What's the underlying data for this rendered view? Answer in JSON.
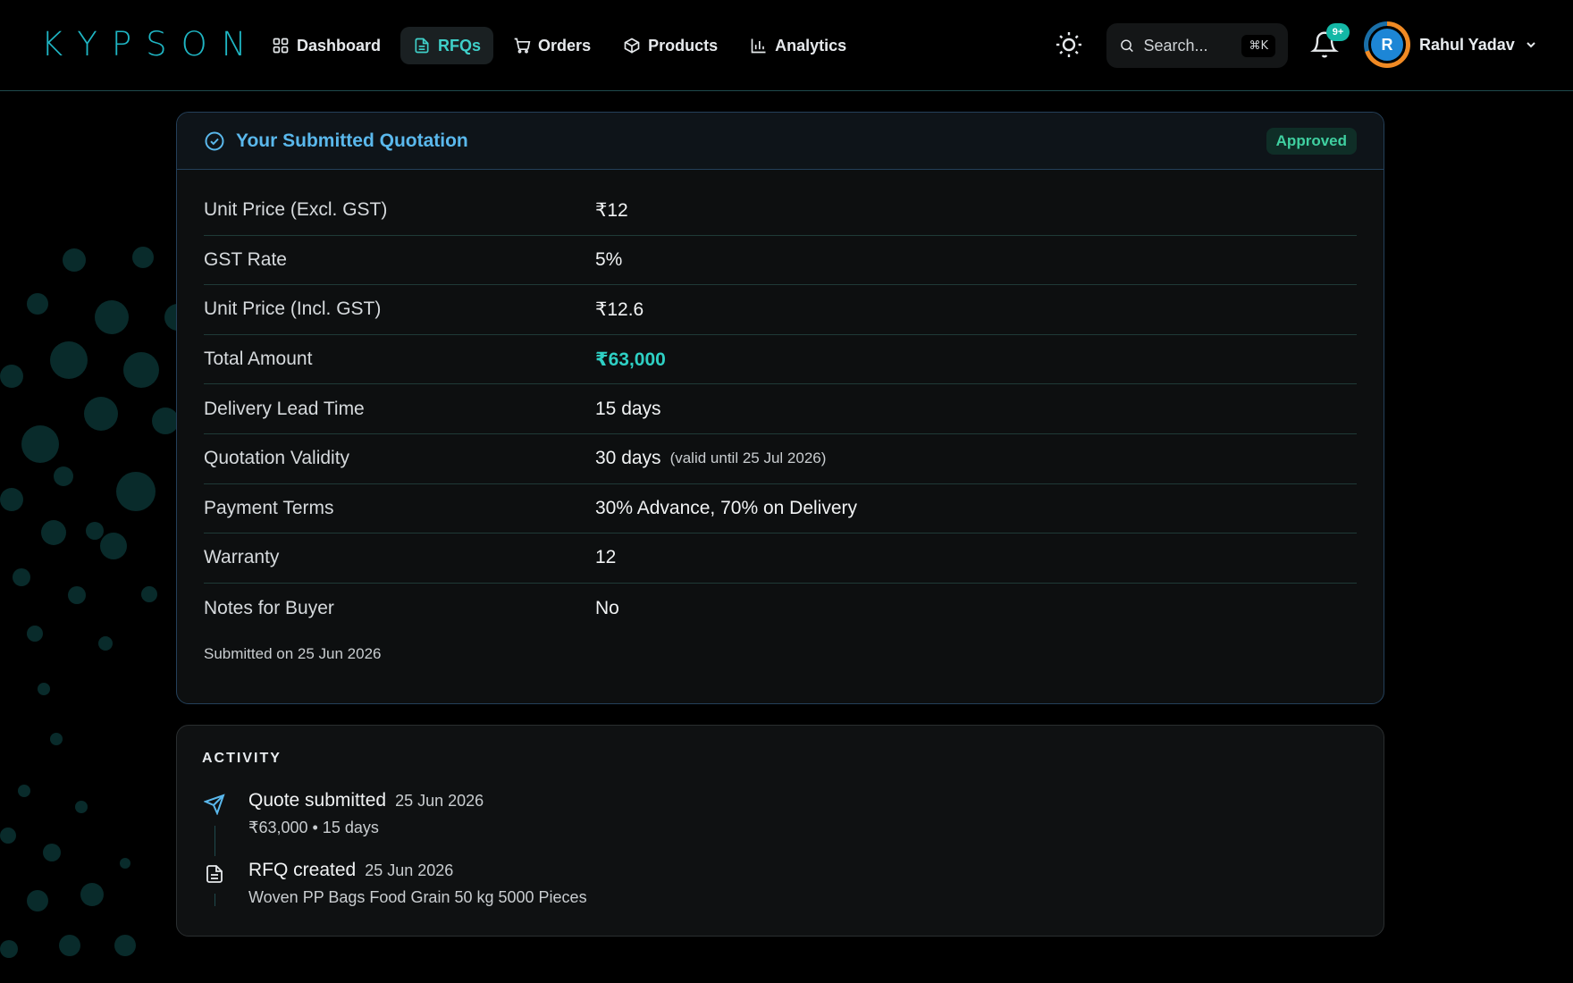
{
  "brand": {
    "logo": "KYPSON"
  },
  "nav": {
    "items": [
      {
        "label": "Dashboard",
        "icon": "grid-icon",
        "active": false
      },
      {
        "label": "RFQs",
        "icon": "document-icon",
        "active": true
      },
      {
        "label": "Orders",
        "icon": "cart-icon",
        "active": false
      },
      {
        "label": "Products",
        "icon": "box-icon",
        "active": false
      },
      {
        "label": "Analytics",
        "icon": "bar-chart-icon",
        "active": false
      }
    ]
  },
  "header": {
    "search_placeholder": "Search...",
    "search_shortcut": "⌘K",
    "notifications_badge": "9+",
    "user": {
      "initial": "R",
      "name": "Rahul Yadav"
    }
  },
  "quotation": {
    "title": "Your Submitted Quotation",
    "status": "Approved",
    "rows": [
      {
        "label": "Unit Price (Excl. GST)",
        "value": "₹12"
      },
      {
        "label": "GST Rate",
        "value": "5%"
      },
      {
        "label": "Unit Price (Incl. GST)",
        "value": "₹12.6"
      },
      {
        "label": "Total Amount",
        "value": "₹63,000"
      },
      {
        "label": "Delivery Lead Time",
        "value": "15 days"
      },
      {
        "label": "Quotation Validity",
        "value": "30 days",
        "note": "(valid until 25 Jul 2026)"
      },
      {
        "label": "Payment Terms",
        "value": "30% Advance, 70% on Delivery"
      },
      {
        "label": "Warranty",
        "value": "12"
      },
      {
        "label": "Notes for Buyer",
        "value": "No"
      }
    ],
    "submitted_text": "Submitted on 25 Jun 2026"
  },
  "activity": {
    "title": "ACTIVITY",
    "items": [
      {
        "title": "Quote submitted",
        "date": "25 Jun 2026",
        "detail": "₹63,000 • 15 days",
        "icon": "send-icon"
      },
      {
        "title": "RFQ created",
        "date": "25 Jun 2026",
        "detail": "Woven PP Bags Food Grain 50 kg 5000 Pieces",
        "icon": "document-icon"
      }
    ]
  },
  "colors": {
    "accent": "#2ed0c4",
    "brand": "#1fb6c4",
    "title_blue": "#5ab8ec",
    "approved": "#3fd0a0"
  }
}
